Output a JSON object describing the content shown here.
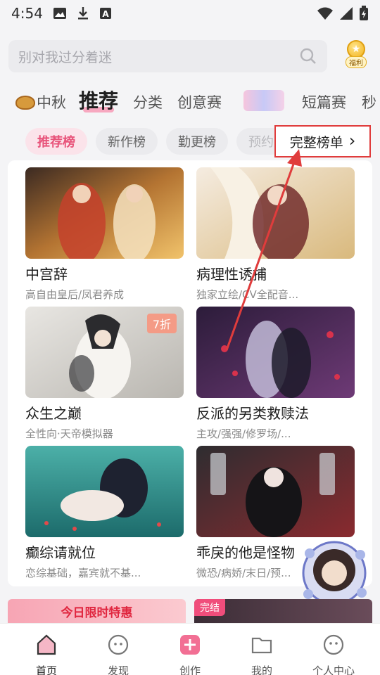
{
  "status": {
    "time": "4:54"
  },
  "search": {
    "placeholder": "别对我过分着迷",
    "welfare_label": "福利"
  },
  "tabs": [
    "中秋",
    "推荐",
    "分类",
    "创意赛",
    "短篇赛",
    "秒"
  ],
  "chips": [
    "推荐榜",
    "新作榜",
    "勤更榜",
    "预约"
  ],
  "full_list": {
    "label": "完整榜单",
    "chevron": "›"
  },
  "books": [
    {
      "title": "中宫辞",
      "tags": "高自由皇后/凤君养成"
    },
    {
      "title": "病理性诱捕",
      "tags": "独家立绘/CV全配音..."
    },
    {
      "title": "众生之巅",
      "tags": "全性向·天帝模拟器",
      "badge": "7折"
    },
    {
      "title": "反派的另类救赎法",
      "tags": "主攻/强强/修罗场/..."
    },
    {
      "title": "癫综请就位",
      "tags": "恋综基础，嘉宾就不基..."
    },
    {
      "title": "乖戾的他是怪物",
      "tags": "微恐/病娇/末日/预..."
    }
  ],
  "promos": {
    "left": "今日限时特惠",
    "right_badge": "完结"
  },
  "nav": [
    "首页",
    "发现",
    "创作",
    "我的",
    "个人中心"
  ],
  "colors": {
    "accent_pink": "#e8537a",
    "annotation_red": "#e03c3c"
  }
}
